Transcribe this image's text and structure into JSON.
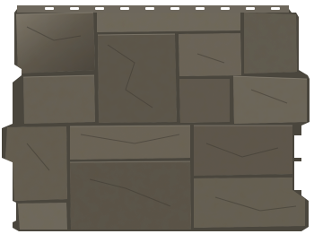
{
  "image": {
    "subject": "facade-stone-panel",
    "colors": {
      "background": "#ffffff",
      "stone_base": "#5e584d",
      "stone_light": "#7d776b",
      "stone_dark": "#3f3b33",
      "grout": "#4a463d",
      "highlight": "#8f897c"
    }
  }
}
